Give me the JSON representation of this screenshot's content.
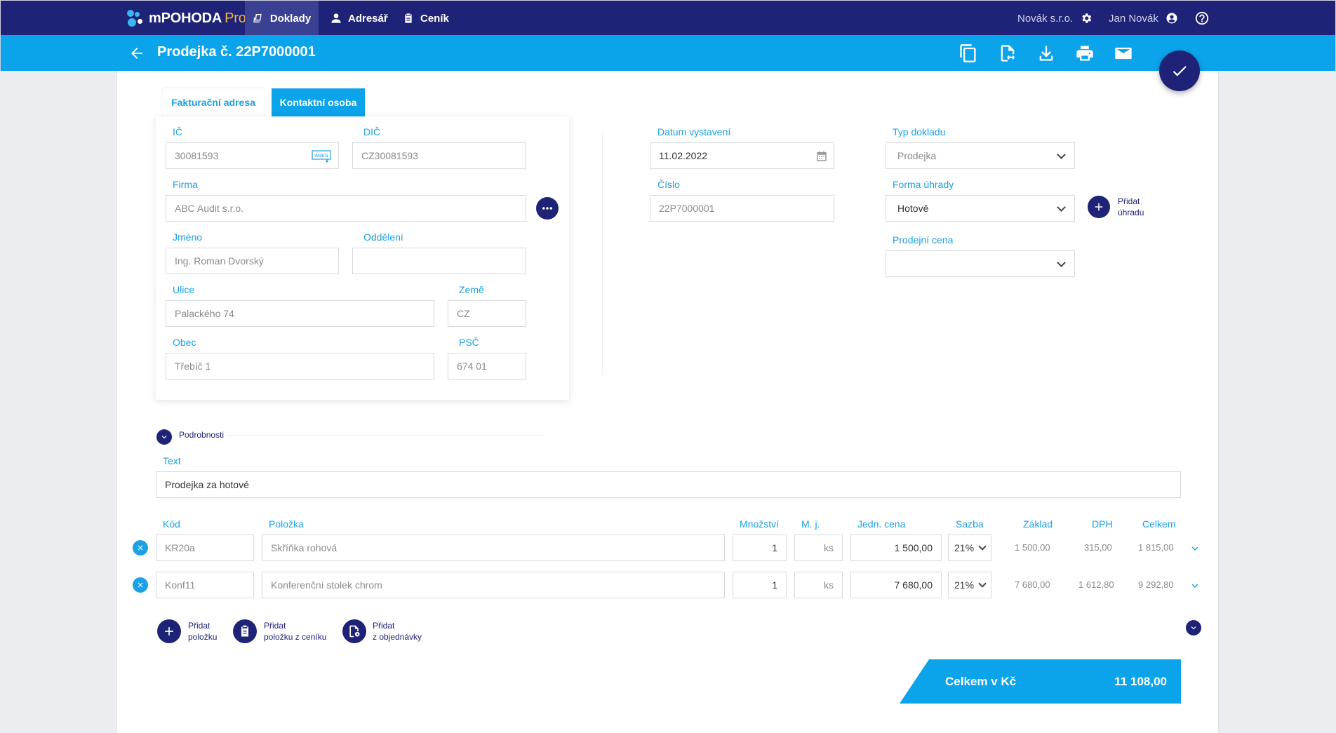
{
  "app": {
    "brand": "mPOHODA",
    "brand_suffix": "Pro",
    "nav": [
      {
        "label": "Doklady",
        "icon": "documents-icon",
        "active": true
      },
      {
        "label": "Adresář",
        "icon": "person-icon",
        "active": false
      },
      {
        "label": "Ceník",
        "icon": "clipboard-icon",
        "active": false
      }
    ],
    "company": "Novák s.r.o.",
    "user": "Jan Novák"
  },
  "document": {
    "title": "Prodejka č. 22P7000001",
    "toolbar_icons": [
      "copy-icon",
      "convert-document-icon",
      "download-icon",
      "print-icon",
      "email-icon"
    ]
  },
  "tabs": {
    "billing": "Fakturační adresa",
    "contact": "Kontaktní osoba"
  },
  "address": {
    "ic_label": "IČ",
    "ic": "30081593",
    "ares_label": "ARES",
    "dic_label": "DIČ",
    "dic": "CZ30081593",
    "firma_label": "Firma",
    "firma": "ABC Audit s.r.o.",
    "jmeno_label": "Jméno",
    "jmeno": "Ing. Roman Dvorský",
    "oddeleni_label": "Oddělení",
    "oddeleni": "",
    "ulice_label": "Ulice",
    "ulice": "Palackého 74",
    "zeme_label": "Země",
    "zeme": "CZ",
    "obec_label": "Obec",
    "obec": "Třebíč 1",
    "psc_label": "PSČ",
    "psc": "674 01"
  },
  "meta": {
    "datum_label": "Datum vystavení",
    "datum": "11.02.2022",
    "cislo_label": "Číslo",
    "cislo": "22P7000001",
    "typ_label": "Typ dokladu",
    "typ": "Prodejka",
    "forma_label": "Forma úhrady",
    "forma": "Hotově",
    "pridat_uhradu_1": "Přidat",
    "pridat_uhradu_2": "úhradu",
    "cena_label": "Prodejní cena",
    "cena": ""
  },
  "details": {
    "toggle_label": "Podrobnosti",
    "text_label": "Text",
    "text": "Prodejka za hotové"
  },
  "items": {
    "headers": {
      "kod": "Kód",
      "polozka": "Položka",
      "mnozstvi": "Množství",
      "mj": "M. j.",
      "jedn_cena": "Jedn. cena",
      "sazba": "Sazba",
      "zaklad": "Základ",
      "dph": "DPH",
      "celkem": "Celkem"
    },
    "rows": [
      {
        "kod": "KR20a",
        "polozka": "Skříňka rohová",
        "mnozstvi": "1",
        "mj": "ks",
        "jedn_cena": "1 500,00",
        "sazba": "21%",
        "zaklad": "1 500,00",
        "dph": "315,00",
        "celkem": "1 815,00"
      },
      {
        "kod": "Konf11",
        "polozka": "Konferenční stolek chrom",
        "mnozstvi": "1",
        "mj": "ks",
        "jedn_cena": "7 680,00",
        "sazba": "21%",
        "zaklad": "7 680,00",
        "dph": "1 612,80",
        "celkem": "9 292,80"
      }
    ],
    "add_buttons": [
      {
        "line1": "Přidat",
        "line2": "položku",
        "icon": "plus-icon"
      },
      {
        "line1": "Přidat",
        "line2": "položku z ceníku",
        "icon": "clipboard-icon"
      },
      {
        "line1": "Přidat",
        "line2": "z objednávky",
        "icon": "order-icon"
      }
    ]
  },
  "total": {
    "label": "Celkem v Kč",
    "value": "11 108,00"
  },
  "colors": {
    "navy": "#1e2377",
    "blue": "#0ba3ea",
    "label_blue": "#1aa1e6",
    "brand_suffix": "#f2b84b"
  }
}
